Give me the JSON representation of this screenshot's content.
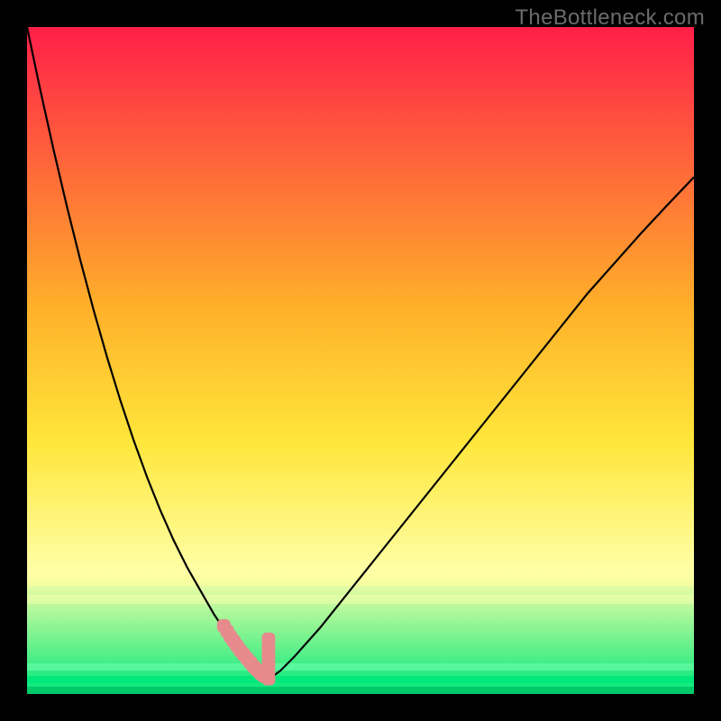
{
  "watermark": "TheBottleneck.com",
  "colors": {
    "frame": "#000000",
    "curve": "#000000",
    "marker_fill": "#e78a8e",
    "marker_stroke": "#e78a8e",
    "gradient_top": "#ff1f49",
    "gradient_mid1": "#ffb02a",
    "gradient_mid2": "#ffe63a",
    "gradient_pale": "#ffffa8",
    "gradient_bottom": "#00e87a"
  },
  "chart_data": {
    "type": "line",
    "title": "",
    "xlabel": "",
    "ylabel": "",
    "xlim": [
      0,
      100
    ],
    "ylim": [
      0,
      100
    ],
    "x": [
      0,
      2,
      4,
      6,
      8,
      10,
      12,
      14,
      16,
      18,
      20,
      22,
      24,
      26,
      28,
      29,
      30,
      31,
      32,
      33,
      34,
      35,
      36,
      38,
      40,
      44,
      48,
      52,
      56,
      60,
      64,
      68,
      72,
      76,
      80,
      84,
      88,
      92,
      96,
      100
    ],
    "values": [
      100,
      90.5,
      81.5,
      73,
      65,
      57.5,
      50.5,
      44,
      38,
      32.5,
      27.5,
      23,
      19,
      15.5,
      12,
      10.5,
      9,
      7.7,
      6.5,
      5.5,
      4.5,
      3,
      2,
      3.5,
      5.5,
      10,
      15,
      20,
      25,
      30,
      35,
      40,
      45,
      50,
      55,
      60,
      64.5,
      69,
      73.3,
      77.5
    ],
    "annotations": {
      "valley_marker_x": [
        29.5,
        30,
        30.5,
        31,
        31.5,
        32,
        32.5,
        33,
        33.5,
        34,
        34.5,
        35,
        35.5,
        36.2,
        36.2,
        36.2,
        36.2,
        36.2,
        36.2
      ],
      "valley_marker_y": [
        10.2,
        9.4,
        8.6,
        7.9,
        7.2,
        6.5,
        5.9,
        5.3,
        4.7,
        4.1,
        3.6,
        3.1,
        2.7,
        2.3,
        3.4,
        4.6,
        5.8,
        7.0,
        8.2
      ]
    }
  }
}
